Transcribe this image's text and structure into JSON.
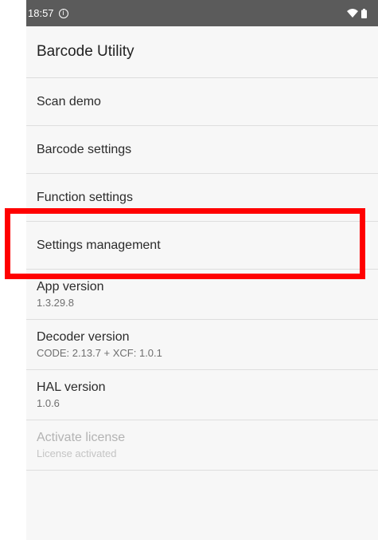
{
  "status_bar": {
    "time": "18:57",
    "info_icon": "info-icon",
    "wifi_icon": "wifi-icon",
    "battery_icon": "battery-icon"
  },
  "app_bar": {
    "title": "Barcode Utility"
  },
  "menu": {
    "items": [
      {
        "label": "Scan demo"
      },
      {
        "label": "Barcode settings"
      },
      {
        "label": "Function settings"
      },
      {
        "label": "Settings management"
      }
    ]
  },
  "info": {
    "app_version": {
      "label": "App version",
      "value": "1.3.29.8"
    },
    "decoder_version": {
      "label": "Decoder version",
      "value": "CODE: 2.13.7 + XCF: 1.0.1"
    },
    "hal_version": {
      "label": "HAL version",
      "value": "1.0.6"
    },
    "license": {
      "label": "Activate license",
      "value": "License activated"
    }
  },
  "colors": {
    "highlight": "#ff0000",
    "status_bar": "#5b5b5b",
    "background": "#f7f7f7"
  }
}
